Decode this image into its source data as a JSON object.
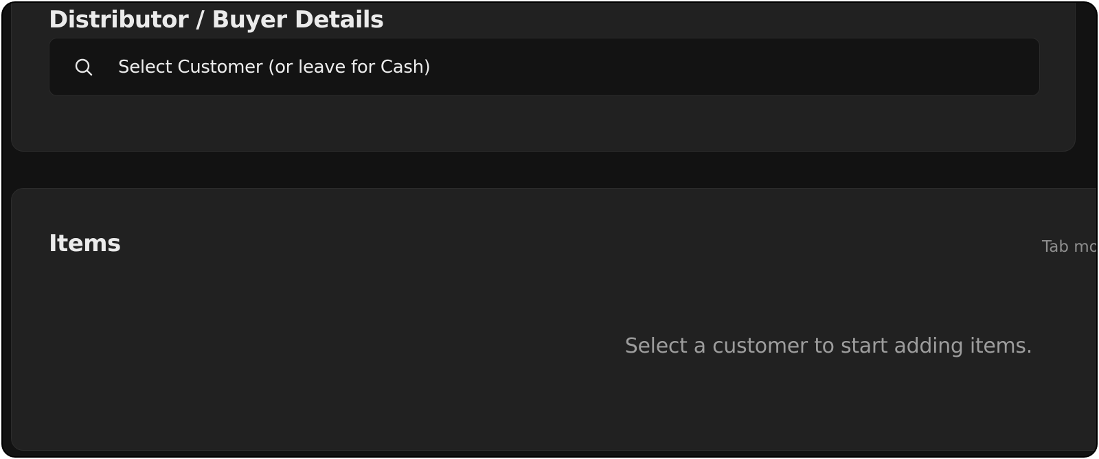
{
  "buyer_section": {
    "title": "Distributor / Buyer Details",
    "search": {
      "icon": "search-icon",
      "placeholder": "Select Customer (or leave for Cash)",
      "value": ""
    }
  },
  "items_section": {
    "title": "Items",
    "tab_hint": "Tab mo",
    "empty_message": "Select a customer to start adding items."
  },
  "colors": {
    "background": "#121212",
    "card": "#212121",
    "input_background": "#131313",
    "primary_text": "#ebebeb",
    "muted_text": "#9d9d9d"
  }
}
